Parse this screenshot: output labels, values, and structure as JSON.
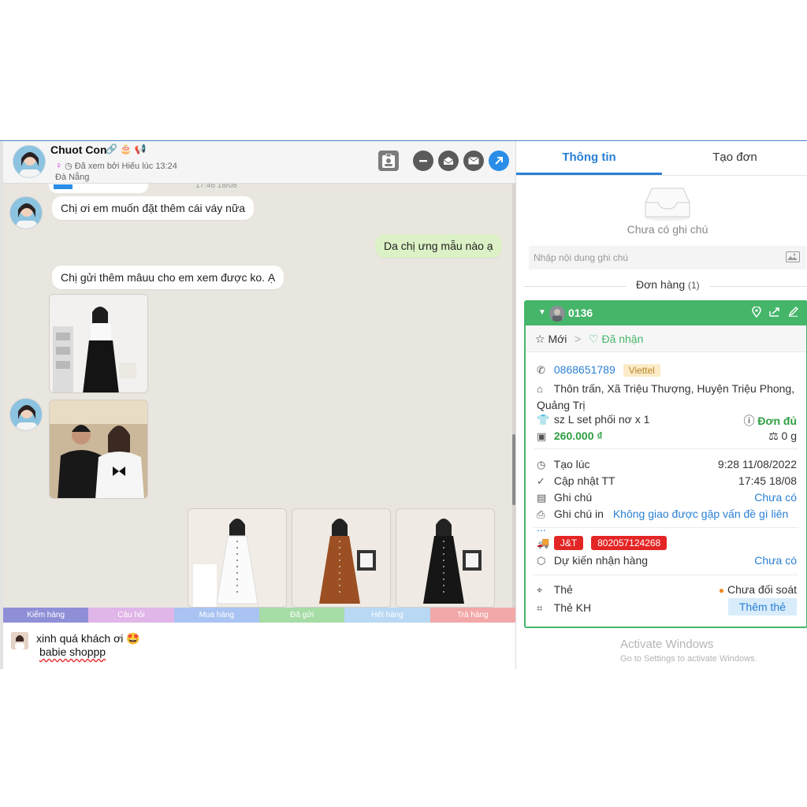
{
  "header": {
    "name": "Chuot Con",
    "tags": "🔗 🎂 📢",
    "gender_icon": "♀",
    "seen": "Đã xem bởi Hiếu lúc 13:24",
    "location": "Đà Nẵng",
    "action_icons": [
      "contact-card-icon",
      "minus-circle-icon",
      "mail-open-icon",
      "mail-icon",
      "share-arrow-icon"
    ]
  },
  "messages": {
    "prev_time": "17:46 18/08",
    "m1": "Chị ơi em muốn đặt thêm cái váy nữa",
    "m2": "Da chị ưng mẫu nào ạ",
    "m3": "Chị gửi thêm mâuu cho em xem được ko. Ạ"
  },
  "quick_tags": [
    {
      "label": "Kiểm hàng",
      "color": "#8f8fd8"
    },
    {
      "label": "Câu hỏi",
      "color": "#e0b5e8"
    },
    {
      "label": "Mua hàng",
      "color": "#a9c3f2"
    },
    {
      "label": "Đã gửi",
      "color": "#a6dca6"
    },
    {
      "label": "Hết hàng",
      "color": "#b8d8f4"
    },
    {
      "label": "Trả hàng",
      "color": "#f2a8a8"
    }
  ],
  "composer": {
    "text": "xinh quá khách ơi 🤩",
    "sub": "babie shoppp"
  },
  "tabs": {
    "info": "Thông tin",
    "create": "Tạo đơn"
  },
  "notes": {
    "empty": "Chưa có ghi chú",
    "placeholder": "Nhập nội dung ghi chú"
  },
  "orders": {
    "label": "Đơn hàng",
    "count": "(1)"
  },
  "order": {
    "code": "0136",
    "status_new": "Mới",
    "status_sep": ">",
    "status_received": "Đã nhận",
    "phone": "0868651789",
    "carrier_badge": "Viettel",
    "address": "Thôn trấn, Xã Triệu Thượng, Huyện Triệu Phong, Quảng Trị",
    "product": "sz L set phối nơ x 1",
    "stock": "Đơn đủ",
    "price": "260.000 ₫",
    "weight": "0 g",
    "created_label": "Tạo lúc",
    "created_value": "9:28 11/08/2022",
    "updated_label": "Cập nhật TT",
    "updated_value": "17:45 18/08",
    "note_label": "Ghi chú",
    "note_value": "Chưa có",
    "print_note_label": "Ghi chú in",
    "print_note_value": "Không giao được gặp vấn đề gì liên ...",
    "carrier": "J&T",
    "tracking": "802057124268",
    "eta_label": "Dự kiến nhận hàng",
    "eta_value": "Chưa có",
    "tag_label": "Thẻ",
    "tag_value": "Chưa đối soát",
    "customer_tag_label": "Thẻ KH",
    "add_tag": "Thêm thẻ"
  },
  "watermark": {
    "line1": "Activate Windows",
    "line2": "Go to Settings to activate Windows."
  },
  "colors": {
    "accent_green": "#45b56a",
    "accent_blue": "#2a7fd4",
    "chat_bg": "#e9e5df",
    "outgoing_bubble": "#dcf2c6",
    "alert_red": "#e42525"
  }
}
